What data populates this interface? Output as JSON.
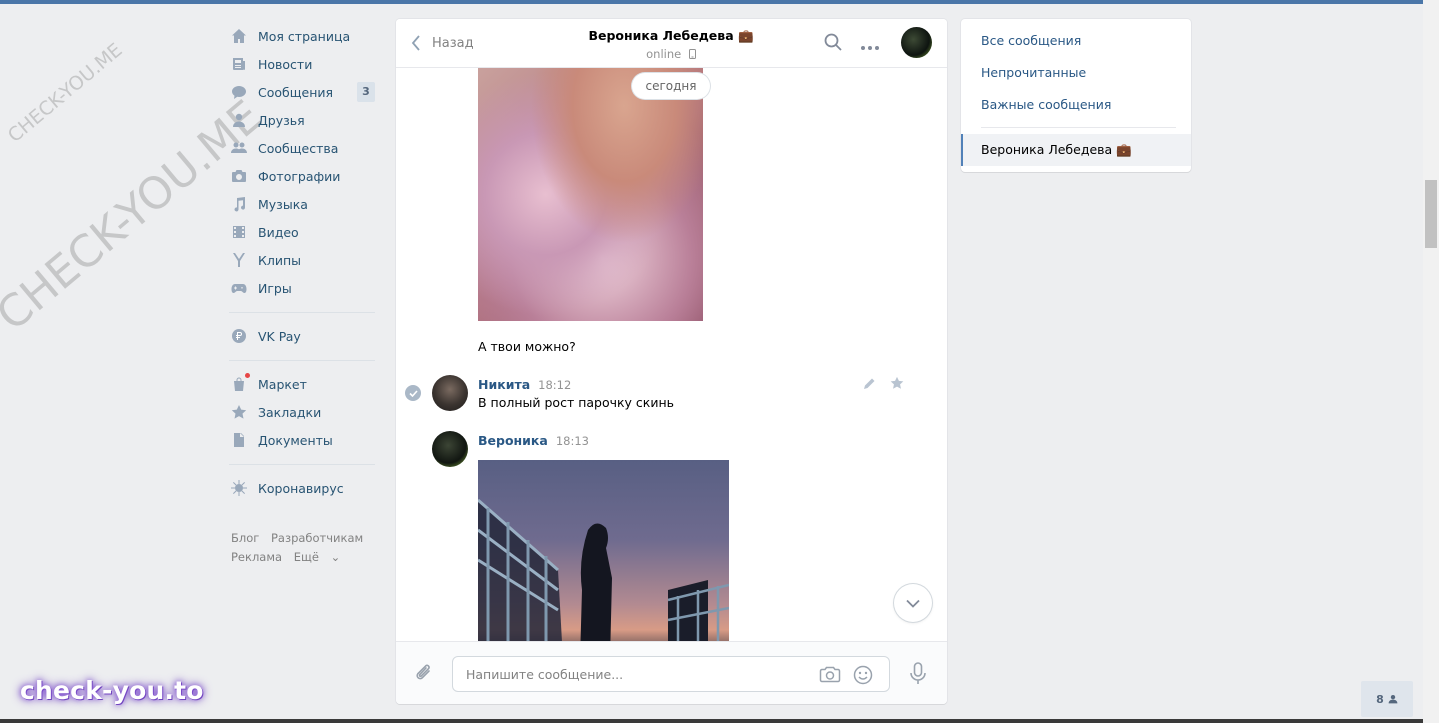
{
  "nav": {
    "items": [
      {
        "label": "Моя страница",
        "icon": "home-icon"
      },
      {
        "label": "Новости",
        "icon": "news-icon"
      },
      {
        "label": "Сообщения",
        "icon": "messages-icon",
        "badge": "3"
      },
      {
        "label": "Друзья",
        "icon": "friends-icon"
      },
      {
        "label": "Сообщества",
        "icon": "communities-icon"
      },
      {
        "label": "Фотографии",
        "icon": "camera-icon"
      },
      {
        "label": "Музыка",
        "icon": "music-icon"
      },
      {
        "label": "Видео",
        "icon": "video-icon"
      },
      {
        "label": "Клипы",
        "icon": "clips-icon"
      },
      {
        "label": "Игры",
        "icon": "gamepad-icon"
      }
    ],
    "vkpay": {
      "label": "VK Pay",
      "icon": "ruble-icon"
    },
    "tools": [
      {
        "label": "Маркет",
        "icon": "market-icon"
      },
      {
        "label": "Закладки",
        "icon": "star-icon"
      },
      {
        "label": "Документы",
        "icon": "document-icon"
      }
    ],
    "corona": {
      "label": "Коронавирус",
      "icon": "virus-icon"
    },
    "footer": {
      "blog": "Блог",
      "dev": "Разработчикам",
      "ads": "Реклама",
      "more": "Ещё"
    }
  },
  "chat": {
    "back_label": "Назад",
    "peer_name": "Вероника Лебедева 💼",
    "peer_status": "online",
    "date_divider": "сегодня",
    "messages": [
      {
        "text": "А твои можно?"
      },
      {
        "author": "Никита",
        "time": "18:12",
        "text": "В полный рост парочку скинь"
      },
      {
        "author": "Вероника",
        "time": "18:13"
      }
    ],
    "composer_placeholder": "Напишите сообщение..."
  },
  "right_panel": {
    "all": "Все сообщения",
    "unread": "Непрочитанные",
    "important": "Важные сообщения",
    "active_chat": "Вероника Лебедева 💼"
  },
  "online_count": "8",
  "watermark": {
    "big": "CHECK-YOU.ME",
    "small": "CHECK-YOU.ME",
    "brand": "check-you.to"
  },
  "colors": {
    "accent": "#4a76a8",
    "link": "#2a5885",
    "nav_icon": "#99a8ba"
  }
}
